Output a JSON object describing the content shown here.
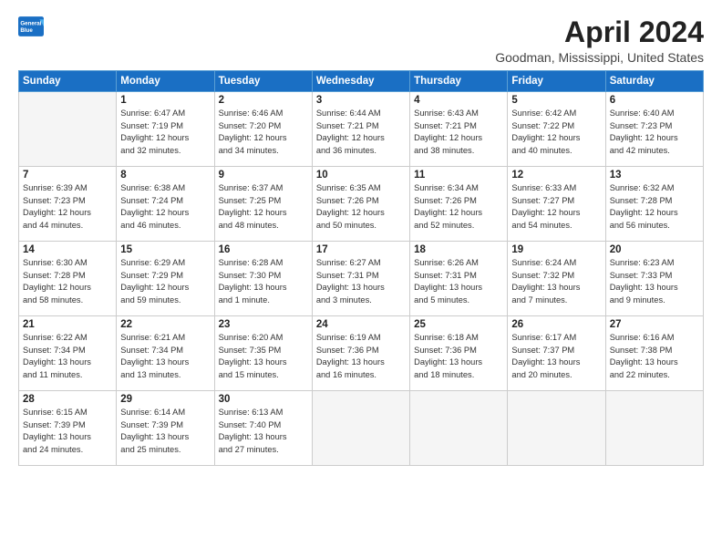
{
  "header": {
    "logo_general": "General",
    "logo_blue": "Blue",
    "month": "April 2024",
    "location": "Goodman, Mississippi, United States"
  },
  "weekdays": [
    "Sunday",
    "Monday",
    "Tuesday",
    "Wednesday",
    "Thursday",
    "Friday",
    "Saturday"
  ],
  "weeks": [
    [
      {
        "day": "",
        "sunrise": "",
        "sunset": "",
        "daylight": ""
      },
      {
        "day": "1",
        "sunrise": "Sunrise: 6:47 AM",
        "sunset": "Sunset: 7:19 PM",
        "daylight": "Daylight: 12 hours and 32 minutes."
      },
      {
        "day": "2",
        "sunrise": "Sunrise: 6:46 AM",
        "sunset": "Sunset: 7:20 PM",
        "daylight": "Daylight: 12 hours and 34 minutes."
      },
      {
        "day": "3",
        "sunrise": "Sunrise: 6:44 AM",
        "sunset": "Sunset: 7:21 PM",
        "daylight": "Daylight: 12 hours and 36 minutes."
      },
      {
        "day": "4",
        "sunrise": "Sunrise: 6:43 AM",
        "sunset": "Sunset: 7:21 PM",
        "daylight": "Daylight: 12 hours and 38 minutes."
      },
      {
        "day": "5",
        "sunrise": "Sunrise: 6:42 AM",
        "sunset": "Sunset: 7:22 PM",
        "daylight": "Daylight: 12 hours and 40 minutes."
      },
      {
        "day": "6",
        "sunrise": "Sunrise: 6:40 AM",
        "sunset": "Sunset: 7:23 PM",
        "daylight": "Daylight: 12 hours and 42 minutes."
      }
    ],
    [
      {
        "day": "7",
        "sunrise": "Sunrise: 6:39 AM",
        "sunset": "Sunset: 7:23 PM",
        "daylight": "Daylight: 12 hours and 44 minutes."
      },
      {
        "day": "8",
        "sunrise": "Sunrise: 6:38 AM",
        "sunset": "Sunset: 7:24 PM",
        "daylight": "Daylight: 12 hours and 46 minutes."
      },
      {
        "day": "9",
        "sunrise": "Sunrise: 6:37 AM",
        "sunset": "Sunset: 7:25 PM",
        "daylight": "Daylight: 12 hours and 48 minutes."
      },
      {
        "day": "10",
        "sunrise": "Sunrise: 6:35 AM",
        "sunset": "Sunset: 7:26 PM",
        "daylight": "Daylight: 12 hours and 50 minutes."
      },
      {
        "day": "11",
        "sunrise": "Sunrise: 6:34 AM",
        "sunset": "Sunset: 7:26 PM",
        "daylight": "Daylight: 12 hours and 52 minutes."
      },
      {
        "day": "12",
        "sunrise": "Sunrise: 6:33 AM",
        "sunset": "Sunset: 7:27 PM",
        "daylight": "Daylight: 12 hours and 54 minutes."
      },
      {
        "day": "13",
        "sunrise": "Sunrise: 6:32 AM",
        "sunset": "Sunset: 7:28 PM",
        "daylight": "Daylight: 12 hours and 56 minutes."
      }
    ],
    [
      {
        "day": "14",
        "sunrise": "Sunrise: 6:30 AM",
        "sunset": "Sunset: 7:28 PM",
        "daylight": "Daylight: 12 hours and 58 minutes."
      },
      {
        "day": "15",
        "sunrise": "Sunrise: 6:29 AM",
        "sunset": "Sunset: 7:29 PM",
        "daylight": "Daylight: 12 hours and 59 minutes."
      },
      {
        "day": "16",
        "sunrise": "Sunrise: 6:28 AM",
        "sunset": "Sunset: 7:30 PM",
        "daylight": "Daylight: 13 hours and 1 minute."
      },
      {
        "day": "17",
        "sunrise": "Sunrise: 6:27 AM",
        "sunset": "Sunset: 7:31 PM",
        "daylight": "Daylight: 13 hours and 3 minutes."
      },
      {
        "day": "18",
        "sunrise": "Sunrise: 6:26 AM",
        "sunset": "Sunset: 7:31 PM",
        "daylight": "Daylight: 13 hours and 5 minutes."
      },
      {
        "day": "19",
        "sunrise": "Sunrise: 6:24 AM",
        "sunset": "Sunset: 7:32 PM",
        "daylight": "Daylight: 13 hours and 7 minutes."
      },
      {
        "day": "20",
        "sunrise": "Sunrise: 6:23 AM",
        "sunset": "Sunset: 7:33 PM",
        "daylight": "Daylight: 13 hours and 9 minutes."
      }
    ],
    [
      {
        "day": "21",
        "sunrise": "Sunrise: 6:22 AM",
        "sunset": "Sunset: 7:34 PM",
        "daylight": "Daylight: 13 hours and 11 minutes."
      },
      {
        "day": "22",
        "sunrise": "Sunrise: 6:21 AM",
        "sunset": "Sunset: 7:34 PM",
        "daylight": "Daylight: 13 hours and 13 minutes."
      },
      {
        "day": "23",
        "sunrise": "Sunrise: 6:20 AM",
        "sunset": "Sunset: 7:35 PM",
        "daylight": "Daylight: 13 hours and 15 minutes."
      },
      {
        "day": "24",
        "sunrise": "Sunrise: 6:19 AM",
        "sunset": "Sunset: 7:36 PM",
        "daylight": "Daylight: 13 hours and 16 minutes."
      },
      {
        "day": "25",
        "sunrise": "Sunrise: 6:18 AM",
        "sunset": "Sunset: 7:36 PM",
        "daylight": "Daylight: 13 hours and 18 minutes."
      },
      {
        "day": "26",
        "sunrise": "Sunrise: 6:17 AM",
        "sunset": "Sunset: 7:37 PM",
        "daylight": "Daylight: 13 hours and 20 minutes."
      },
      {
        "day": "27",
        "sunrise": "Sunrise: 6:16 AM",
        "sunset": "Sunset: 7:38 PM",
        "daylight": "Daylight: 13 hours and 22 minutes."
      }
    ],
    [
      {
        "day": "28",
        "sunrise": "Sunrise: 6:15 AM",
        "sunset": "Sunset: 7:39 PM",
        "daylight": "Daylight: 13 hours and 24 minutes."
      },
      {
        "day": "29",
        "sunrise": "Sunrise: 6:14 AM",
        "sunset": "Sunset: 7:39 PM",
        "daylight": "Daylight: 13 hours and 25 minutes."
      },
      {
        "day": "30",
        "sunrise": "Sunrise: 6:13 AM",
        "sunset": "Sunset: 7:40 PM",
        "daylight": "Daylight: 13 hours and 27 minutes."
      },
      {
        "day": "",
        "sunrise": "",
        "sunset": "",
        "daylight": ""
      },
      {
        "day": "",
        "sunrise": "",
        "sunset": "",
        "daylight": ""
      },
      {
        "day": "",
        "sunrise": "",
        "sunset": "",
        "daylight": ""
      },
      {
        "day": "",
        "sunrise": "",
        "sunset": "",
        "daylight": ""
      }
    ]
  ]
}
